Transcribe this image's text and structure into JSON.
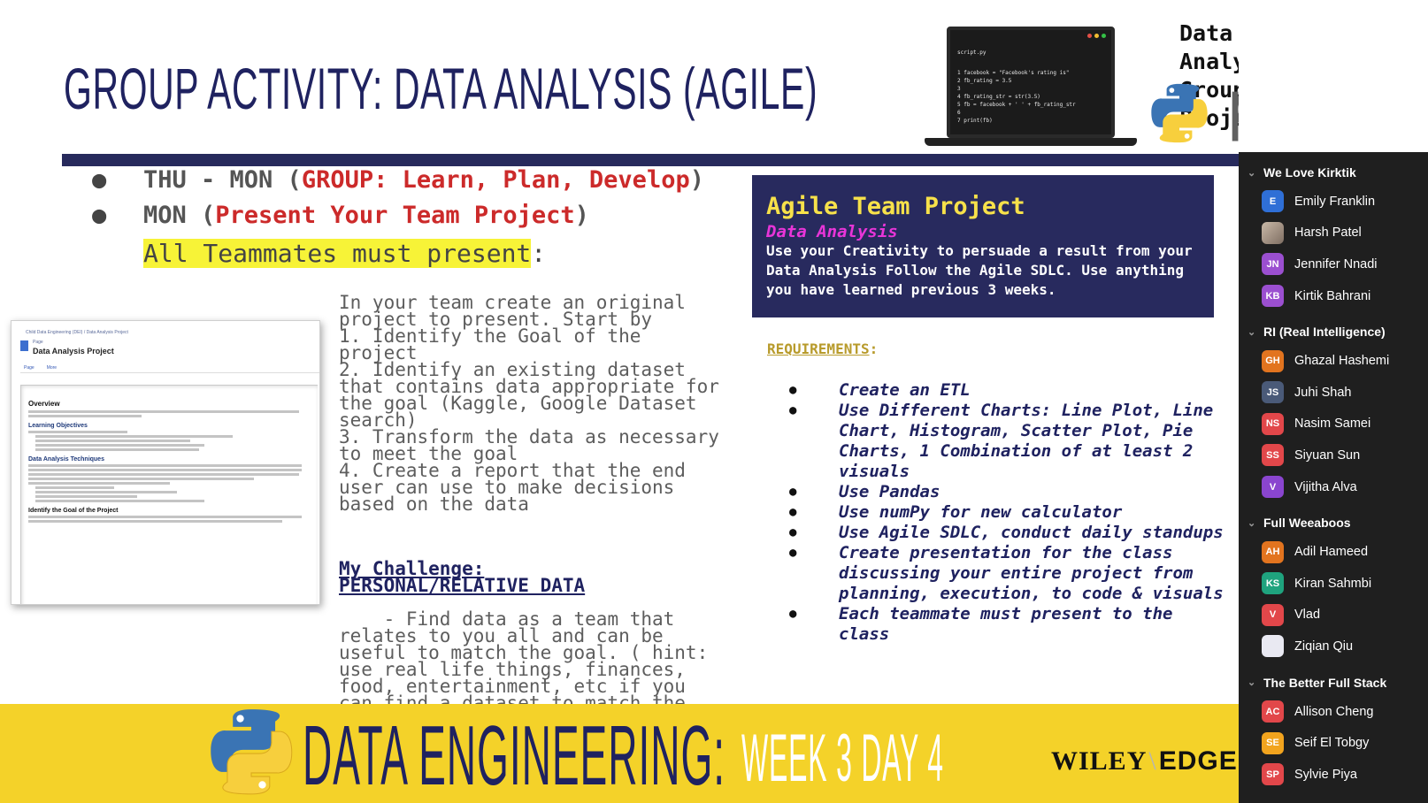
{
  "slide": {
    "title": "GROUP ACTIVITY: DATA ANALYSIS (AGILE)",
    "project_heading": [
      "Data Analysis",
      "Group Project"
    ],
    "python_word": "python",
    "laptop": {
      "file": "script.py",
      "code": "1 facebook = \"Facebook's rating is\"\n2 fb_rating = 3.5\n3\n4 fb_rating_str = str(3.5)\n5 fb = facebook + ' ' + fb_rating_str\n6\n7 print(fb)"
    },
    "bullets": [
      {
        "lead": "THU - MON (",
        "red": "GROUP: Learn, Plan, Develop",
        "tail": ")"
      },
      {
        "lead": "MON (",
        "red": "Present Your Team Project",
        "tail": ")"
      }
    ],
    "must_present": {
      "highlight": "All Teammates must present",
      "tail": ":"
    },
    "doc": {
      "breadcrumb": "Child Data Engineering (DEI)  /  Data Analysis Project",
      "page_label": "Page",
      "title": "Data Analysis Project",
      "tabs": [
        "Page",
        "More"
      ],
      "sections": [
        "Overview",
        "Learning Objectives",
        "Data Analysis Techniques",
        "Identify the Goal of the Project"
      ]
    },
    "instructions": "In your team create an original project to present. Start by\n1. Identify the Goal of the project\n2. Identify an existing dataset that contains data appropriate for the goal (Kaggle, Google Dataset search)\n3. Transform the data as necessary to meet the goal\n4. Create a report that the end user can use to make decisions based on the data",
    "challenge": {
      "heading": "My Challenge:\nPERSONAL/RELATIVE DATA",
      "text": "- Find data as a team that relates to you all and can be useful to match the goal. ( hint: use real life things, finances, food, entertainment, etc if you can find a dataset to match the goal"
    },
    "agile": {
      "title": "Agile Team Project",
      "subtitle": "Data Analysis",
      "text": "Use your Creativity to persuade a result from your Data Analysis Follow the Agile SDLC. Use anything you have learned previous 3 weeks."
    },
    "requirements_heading": "REQUIREMENTS",
    "requirements": [
      "Create an ETL",
      "Use Different Charts: Line Plot, Line Chart, Histogram, Scatter Plot, Pie Charts, 1 Combination of at least 2 visuals",
      "Use Pandas",
      "Use numPy for new calculator",
      "Use Agile SDLC, conduct daily standups",
      "Create presentation for the class discussing your entire project from planning, execution, to code & visuals",
      "Each teammate must present to the class"
    ],
    "footer": {
      "main": "DATA ENGINEERING",
      "colon": ":",
      "week": "WEEK 3 DAY 4",
      "brand_left": "WILEY",
      "brand_right": "EDGE"
    }
  },
  "panel": {
    "groups": [
      {
        "name": "We Love Kirktik",
        "members": [
          {
            "name": "Emily Franklin",
            "initials": "E",
            "color": "#2f6fd6"
          },
          {
            "name": "Harsh Patel",
            "initials": "",
            "color": "photo"
          },
          {
            "name": "Jennifer Nnadi",
            "initials": "JN",
            "color": "#9b4fd0"
          },
          {
            "name": "Kirtik Bahrani",
            "initials": "KB",
            "color": "#9b4fd0"
          }
        ]
      },
      {
        "name": "RI (Real Intelligence)",
        "members": [
          {
            "name": "Ghazal Hashemi",
            "initials": "GH",
            "color": "#e2741f"
          },
          {
            "name": "Juhi Shah",
            "initials": "JS",
            "color": "#4a5a78"
          },
          {
            "name": "Nasim Samei",
            "initials": "NS",
            "color": "#e2474a"
          },
          {
            "name": "Siyuan Sun",
            "initials": "SS",
            "color": "#e2474a"
          },
          {
            "name": "Vijitha Alva",
            "initials": "V",
            "color": "#8a45cf"
          }
        ]
      },
      {
        "name": "Full Weeaboos",
        "members": [
          {
            "name": "Adil Hameed",
            "initials": "AH",
            "color": "#e2741f"
          },
          {
            "name": "Kiran Sahmbi",
            "initials": "KS",
            "color": "#1fa37e"
          },
          {
            "name": "Vlad",
            "initials": "V",
            "color": "#e2474a"
          },
          {
            "name": "Ziqian Qiu",
            "initials": "",
            "color": "pic"
          }
        ]
      },
      {
        "name": "The Better Full Stack",
        "members": [
          {
            "name": "Allison Cheng",
            "initials": "AC",
            "color": "#e2474a"
          },
          {
            "name": "Seif El Tobgy",
            "initials": "SE",
            "color": "#f2a41e"
          },
          {
            "name": "Sylvie Piya",
            "initials": "SP",
            "color": "#e2474a"
          }
        ]
      }
    ]
  }
}
